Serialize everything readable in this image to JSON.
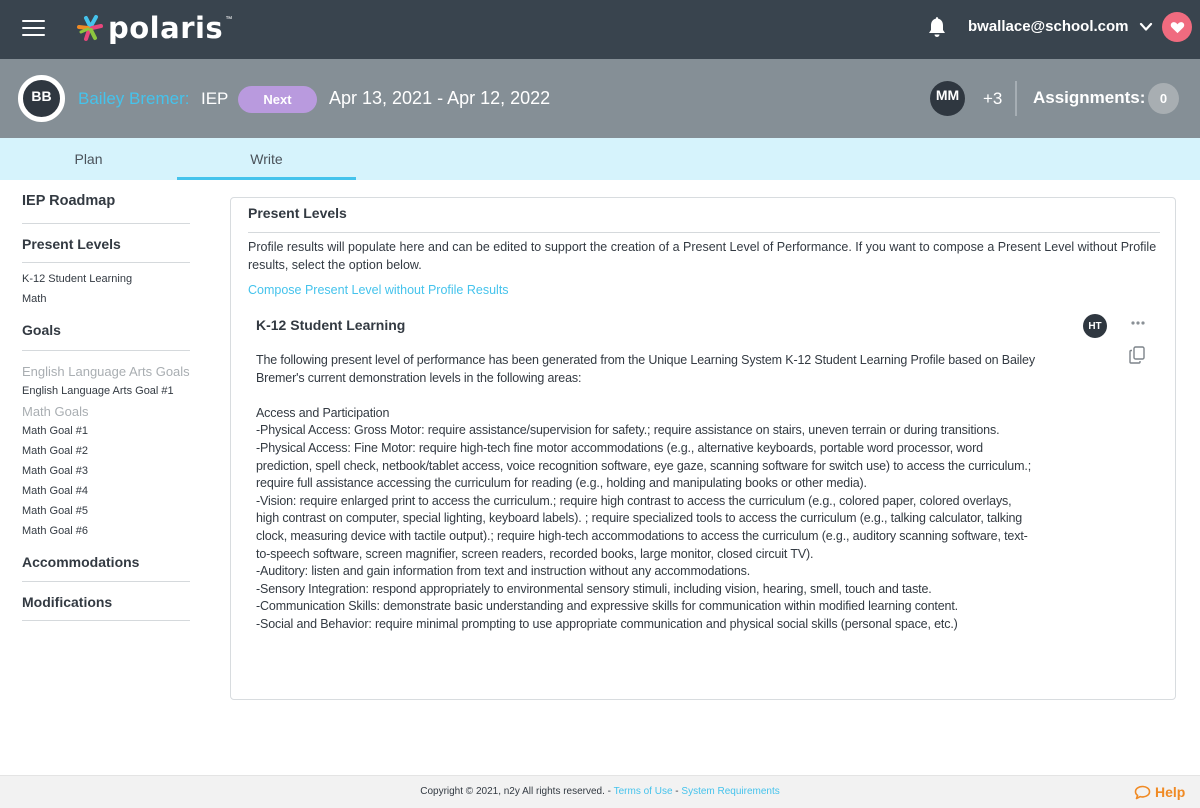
{
  "topbar": {
    "brand": "polaris",
    "brand_tm": "™",
    "user_email": "bwallace@school.com",
    "icons": {
      "menu": "hamburger-menu-icon",
      "notifications": "bell-icon",
      "user_menu": "chevron-down-icon",
      "favorites": "heart-icon"
    }
  },
  "student_bar": {
    "avatar_initials": "BB",
    "student_name": "Bailey Bremer:",
    "document_type": "IEP",
    "next_label": "Next",
    "date_range": "Apr 13, 2021 - Apr 12, 2022",
    "collaborator_initials": "MM",
    "additional_collaborators": "+3",
    "assignments_label": "Assignments:",
    "assignments_count": "0"
  },
  "tabs": [
    {
      "label": "Plan",
      "active": false
    },
    {
      "label": "Write",
      "active": true
    }
  ],
  "sidebar": {
    "roadmap_title": "IEP Roadmap",
    "present_levels": {
      "heading": "Present Levels",
      "items": [
        "K-12 Student Learning",
        "Math"
      ]
    },
    "goals": {
      "heading": "Goals",
      "ela_group": "English Language Arts Goals",
      "ela_items": [
        "English Language Arts Goal #1"
      ],
      "math_group": "Math Goals",
      "math_items": [
        "Math Goal #1",
        "Math Goal #2",
        "Math Goal #3",
        "Math Goal #4",
        "Math Goal #5",
        "Math Goal #6"
      ]
    },
    "accommodations": "Accommodations",
    "modifications": "Modifications"
  },
  "main": {
    "title": "Present Levels",
    "intro": "Profile results will populate here and can be edited to support the creation of a Present Level of Performance. If you want to compose a Present Level without Profile results, select the option below.",
    "compose_link": "Compose Present Level without Profile Results",
    "section": {
      "title": "K-12 Student Learning",
      "editor_initials": "HT",
      "more_icon": "more-options-icon",
      "copy_icon": "copy-icon",
      "body": "The following present level of performance has been generated from the Unique Learning System K-12 Student Learning Profile based on Bailey Bremer's current demonstration levels in the following areas:\n\nAccess and Participation\n-Physical Access: Gross Motor: require assistance/supervision for safety.; require assistance on stairs, uneven terrain or during transitions.\n-Physical Access: Fine Motor: require high-tech fine motor accommodations (e.g., alternative keyboards, portable word processor, word prediction, spell check, netbook/tablet access, voice recognition software, eye gaze, scanning software for switch use) to access the curriculum.; require full assistance accessing the curriculum for reading (e.g., holding and manipulating books or other media).\n-Vision: require enlarged print to access the curriculum.; require high contrast to access the curriculum (e.g., colored paper, colored overlays, high contrast on computer, special lighting, keyboard labels). ; require specialized tools to access the curriculum (e.g., talking calculator, talking clock, measuring device with tactile output).; require high-tech accommodations to access the curriculum (e.g., auditory scanning software, text-to-speech software, screen magnifier, screen readers, recorded books, large monitor, closed circuit TV).\n-Auditory: listen and gain information from text and instruction without any accommodations.\n-Sensory Integration: respond appropriately to environmental sensory stimuli, including vision, hearing, smell, touch and taste.\n-Communication Skills: demonstrate basic understanding and expressive skills for communication within modified learning content.\n-Social and Behavior: require minimal prompting to use appropriate communication and physical social skills (personal space, etc.)"
    }
  },
  "footer": {
    "copyright": "Copyright © 2021, n2y All rights reserved. - ",
    "terms_link": "Terms of Use",
    "separator": " - ",
    "requirements_link": "System Requirements",
    "help_label": "Help"
  },
  "colors": {
    "topbar_bg": "#39444e",
    "student_bar_bg": "#858f96",
    "tab_bar_bg": "#d6f3fc",
    "accent_blue": "#45c3ec",
    "next_button": "#b99ade",
    "heart_button": "#f06b7f",
    "help_orange": "#f08a24"
  }
}
